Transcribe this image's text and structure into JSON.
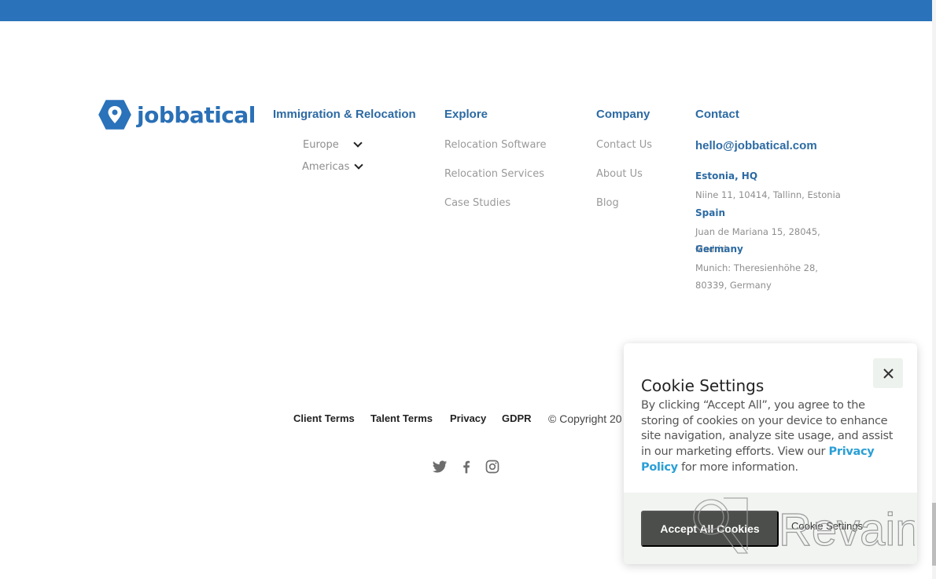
{
  "brand": {
    "name": "jobbatical",
    "color": "#2a72ba"
  },
  "columns": {
    "immigration": {
      "heading": "Immigration & Relocation",
      "regions": [
        {
          "label": "Europe",
          "icon": "chevron-down-icon"
        },
        {
          "label": "Americas",
          "icon": "chevron-down-icon"
        }
      ]
    },
    "explore": {
      "heading": "Explore",
      "links": [
        "Relocation Software",
        "Relocation Services",
        "Case Studies"
      ]
    },
    "company": {
      "heading": "Company",
      "links": [
        "Contact Us",
        "About Us",
        "Blog"
      ]
    },
    "contact": {
      "heading": "Contact",
      "email": "hello@jobbatical.com",
      "offices": [
        {
          "name": "Estonia, HQ",
          "address": "Niine 11, 10414, Tallinn, Estonia"
        },
        {
          "name": "Spain",
          "address": "Juan de Mariana 15, 28045, Madrid"
        },
        {
          "name": "Germany",
          "address": "Munich: Theresienhöhe 28, 80339, Germany"
        }
      ]
    }
  },
  "legal": {
    "links": [
      "Client Terms",
      "Talent Terms",
      "Privacy",
      "GDPR"
    ],
    "copyright": "© Copyright 20"
  },
  "social": [
    "twitter-icon",
    "facebook-icon",
    "instagram-icon"
  ],
  "cookie_banner": {
    "title": "Cookie Settings",
    "text_before_link": "By clicking “Accept All”, you agree to the storing of cookies on your device to enhance site navigation, analyze site usage, and assist in our marketing efforts. View our ",
    "link_label": "Privacy Policy",
    "text_after_link": " for more information.",
    "accept_label": "Accept All Cookies",
    "settings_label": "Cookie Settings",
    "close_icon": "close-icon"
  },
  "watermark": {
    "text": "Revain"
  }
}
